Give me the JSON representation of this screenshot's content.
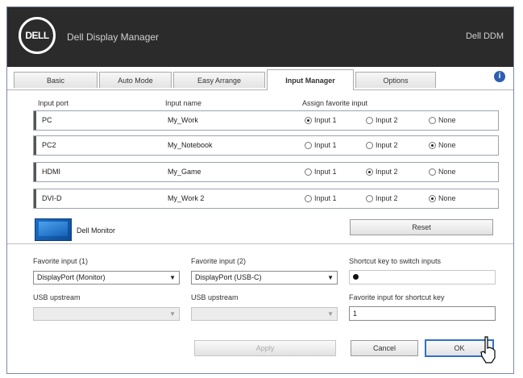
{
  "window": {
    "logo": "DELL",
    "title": "Dell Display Manager",
    "version": "Dell DDM"
  },
  "tabs": [
    {
      "label": "Basic",
      "active": false
    },
    {
      "label": "Auto Mode",
      "active": false
    },
    {
      "label": "Easy Arrange",
      "active": false
    },
    {
      "label": "Input Manager",
      "active": true
    },
    {
      "label": "Options",
      "active": false
    }
  ],
  "table": {
    "headers": [
      "Input port",
      "Input name",
      "Assign favorite input"
    ],
    "rows": [
      {
        "port": "PC",
        "name": "My_Work",
        "choices": [
          "Input 1",
          "Input 2",
          "None"
        ],
        "selected": 0
      },
      {
        "port": "PC2",
        "name": "My_Notebook",
        "choices": [
          "Input 1",
          "Input 2",
          "None"
        ],
        "selected": 2
      },
      {
        "port": "HDMI",
        "name": "My_Game",
        "choices": [
          "Input 1",
          "Input 2",
          "None"
        ],
        "selected": 1
      },
      {
        "port": "DVI-D",
        "name": "My_Work 2",
        "choices": [
          "Input 1",
          "Input 2",
          "None"
        ],
        "selected": 2
      }
    ]
  },
  "monitor": {
    "label": "Dell Monitor"
  },
  "reset_button": "Reset",
  "form": {
    "input_left_label": "Favorite input (1)",
    "input_left_value": "DisplayPort (Monitor)",
    "input_right_label": "Favorite input (2)",
    "input_right_value": "DisplayPort (USB-C)",
    "shortcut_label": "Shortcut key to switch inputs",
    "shortcut_value": "",
    "sub_left_label": "USB upstream",
    "sub_left_value": "",
    "sub_right_label": "USB upstream",
    "sub_right_value": "",
    "favorite_label": "Favorite input for shortcut key",
    "favorite_value": "1"
  },
  "buttons": {
    "apply": "Apply",
    "cancel": "Cancel",
    "ok": "OK"
  }
}
